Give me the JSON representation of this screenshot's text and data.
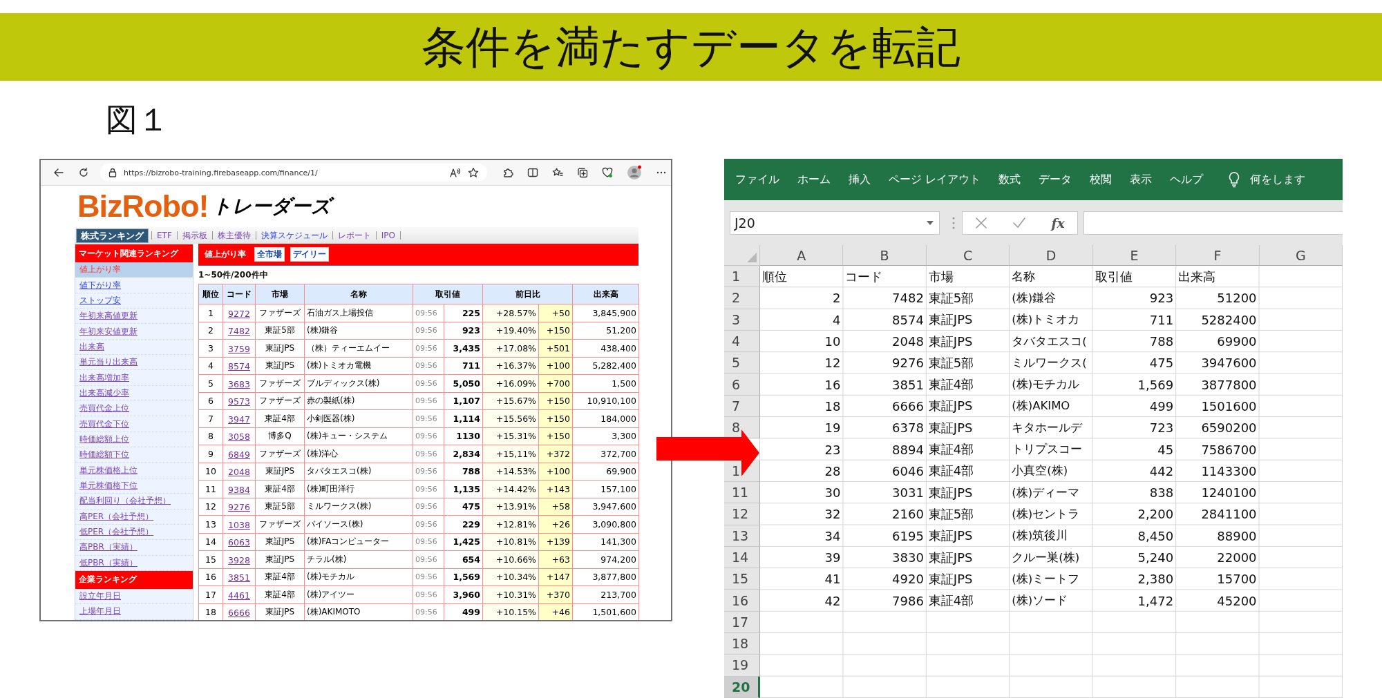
{
  "slide": {
    "title": "条件を満たすデータを転記",
    "figure_label": "図１"
  },
  "browser": {
    "url": "https://bizrobo-training.firebaseapp.com/finance/1/",
    "site": {
      "logo_text": "BizRobo!",
      "logo_subtitle": "トレーダーズ",
      "nav": [
        {
          "label": "株式ランキング",
          "selected": true,
          "visited": false
        },
        {
          "label": "ETF",
          "selected": false,
          "visited": true
        },
        {
          "label": "掲示板",
          "selected": false,
          "visited": true
        },
        {
          "label": "株主優待",
          "selected": false,
          "visited": true
        },
        {
          "label": "決算スケジュール",
          "selected": false,
          "visited": false
        },
        {
          "label": "レポート",
          "selected": false,
          "visited": true
        },
        {
          "label": "IPO",
          "selected": false,
          "visited": true
        }
      ],
      "sidebar": [
        {
          "kind": "header",
          "label": "マーケット関連ランキング"
        },
        {
          "kind": "link",
          "label": "値上がり率",
          "selected": true,
          "visited": false
        },
        {
          "kind": "link",
          "label": "値下がり率",
          "selected": false,
          "visited": false
        },
        {
          "kind": "link",
          "label": "ストップ安",
          "selected": false,
          "visited": false
        },
        {
          "kind": "link",
          "label": "年初来高値更新",
          "selected": false,
          "visited": true
        },
        {
          "kind": "link",
          "label": "年初来安値更新",
          "selected": false,
          "visited": true
        },
        {
          "kind": "link",
          "label": "出来高",
          "selected": false,
          "visited": true
        },
        {
          "kind": "link",
          "label": "単元当り出来高",
          "selected": false,
          "visited": true
        },
        {
          "kind": "link",
          "label": "出来高増加率",
          "selected": false,
          "visited": true
        },
        {
          "kind": "link",
          "label": "出来高減少率",
          "selected": false,
          "visited": true
        },
        {
          "kind": "link",
          "label": "売買代金上位",
          "selected": false,
          "visited": true
        },
        {
          "kind": "link",
          "label": "売買代金下位",
          "selected": false,
          "visited": true
        },
        {
          "kind": "link",
          "label": "時価総額上位",
          "selected": false,
          "visited": true
        },
        {
          "kind": "link",
          "label": "時価総額下位",
          "selected": false,
          "visited": true
        },
        {
          "kind": "link",
          "label": "単元株価格上位",
          "selected": false,
          "visited": true
        },
        {
          "kind": "link",
          "label": "単元株価格下位",
          "selected": false,
          "visited": true
        },
        {
          "kind": "link",
          "label": "配当利回り（会社予想）",
          "selected": false,
          "visited": true
        },
        {
          "kind": "link",
          "label": "高PER（会社予想）",
          "selected": false,
          "visited": true
        },
        {
          "kind": "link",
          "label": "低PER（会社予想）",
          "selected": false,
          "visited": true
        },
        {
          "kind": "link",
          "label": "高PBR（実績）",
          "selected": false,
          "visited": true
        },
        {
          "kind": "link",
          "label": "低PBR（実績）",
          "selected": false,
          "visited": true
        },
        {
          "kind": "header",
          "label": "企業ランキング"
        },
        {
          "kind": "link",
          "label": "設立年月日",
          "selected": false,
          "visited": true
        },
        {
          "kind": "link",
          "label": "上場年月日",
          "selected": false,
          "visited": true
        }
      ],
      "panel": {
        "title": "値上がり率",
        "filters": [
          "全市場",
          "デイリー"
        ],
        "count": "1~50件/200件中"
      },
      "table": {
        "columns": [
          "順位",
          "コード",
          "市場",
          "名称",
          "取引値",
          "前日比",
          "出来高"
        ],
        "rows": [
          {
            "rank": "1",
            "code": "9272",
            "market": "ファザーズ",
            "name": "石油ガス上場投信",
            "time": "09:56",
            "price": "225",
            "change_pct": "+28.57%",
            "change": "+50",
            "volume": "3,845,900"
          },
          {
            "rank": "2",
            "code": "7482",
            "market": "東証5部",
            "name": "(株)鎌谷",
            "time": "09:56",
            "price": "923",
            "change_pct": "+19.40%",
            "change": "+150",
            "volume": "51,200"
          },
          {
            "rank": "3",
            "code": "3759",
            "market": "東証JPS",
            "name": "（株）ティーエムイー",
            "time": "09:56",
            "price": "3,435",
            "change_pct": "+17.08%",
            "change": "+501",
            "volume": "438,400"
          },
          {
            "rank": "4",
            "code": "8574",
            "market": "東証JPS",
            "name": "(株)トミオカ電機",
            "time": "09:56",
            "price": "711",
            "change_pct": "+16.37%",
            "change": "+100",
            "volume": "5,282,400"
          },
          {
            "rank": "5",
            "code": "3683",
            "market": "ファザーズ",
            "name": "ブルディックス(株)",
            "time": "09:56",
            "price": "5,050",
            "change_pct": "+16.09%",
            "change": "+700",
            "volume": "1,500"
          },
          {
            "rank": "6",
            "code": "9573",
            "market": "ファザーズ",
            "name": "赤の製紙(株)",
            "time": "09:56",
            "price": "1,107",
            "change_pct": "+15.67%",
            "change": "+150",
            "volume": "10,910,100"
          },
          {
            "rank": "7",
            "code": "3947",
            "market": "東証4部",
            "name": "小剣医器(株)",
            "time": "09:56",
            "price": "1,114",
            "change_pct": "+15.56%",
            "change": "+150",
            "volume": "184,000"
          },
          {
            "rank": "8",
            "code": "3058",
            "market": "博多Q",
            "name": "(株)キュー・システム",
            "time": "09:56",
            "price": "1130",
            "change_pct": "+15.31%",
            "change": "+150",
            "volume": "3,300"
          },
          {
            "rank": "9",
            "code": "6849",
            "market": "ファザーズ",
            "name": "(株)洋心",
            "time": "09:56",
            "price": "2,834",
            "change_pct": "+15,11%",
            "change": "+372",
            "volume": "372,700"
          },
          {
            "rank": "10",
            "code": "2048",
            "market": "東証JPS",
            "name": "タバタエスコ(株)",
            "time": "09:56",
            "price": "788",
            "change_pct": "+14.53%",
            "change": "+100",
            "volume": "69,900"
          },
          {
            "rank": "11",
            "code": "9384",
            "market": "東証4部",
            "name": "(株)町田洋行",
            "time": "09:56",
            "price": "1,135",
            "change_pct": "+14.42%",
            "change": "+143",
            "volume": "157,100"
          },
          {
            "rank": "12",
            "code": "9276",
            "market": "東証5部",
            "name": "ミルワークス(株)",
            "time": "09:56",
            "price": "475",
            "change_pct": "+13.91%",
            "change": "+58",
            "volume": "3,947,600"
          },
          {
            "rank": "13",
            "code": "1038",
            "market": "ファザーズ",
            "name": "バイソース(株)",
            "time": "09:56",
            "price": "229",
            "change_pct": "+12.81%",
            "change": "+26",
            "volume": "3,090,800"
          },
          {
            "rank": "14",
            "code": "6063",
            "market": "東証JPS",
            "name": "(株)FAコンピューター",
            "time": "09:56",
            "price": "1,425",
            "change_pct": "+10.81%",
            "change": "+139",
            "volume": "141,300"
          },
          {
            "rank": "15",
            "code": "3928",
            "market": "東証JPS",
            "name": "チラル(株)",
            "time": "09:56",
            "price": "654",
            "change_pct": "+10.66%",
            "change": "+63",
            "volume": "974,200"
          },
          {
            "rank": "16",
            "code": "3851",
            "market": "東証4部",
            "name": "(株)モチカル",
            "time": "09:56",
            "price": "1,569",
            "change_pct": "+10.34%",
            "change": "+147",
            "volume": "3,877,800"
          },
          {
            "rank": "17",
            "code": "4461",
            "market": "東証4部",
            "name": "(株)アイツー",
            "time": "09:56",
            "price": "3,960",
            "change_pct": "+10.31%",
            "change": "+370",
            "volume": "213,700"
          },
          {
            "rank": "18",
            "code": "6666",
            "market": "東証JPS",
            "name": "(株)AKIMOTO",
            "time": "09:56",
            "price": "499",
            "change_pct": "+10.15%",
            "change": "+46",
            "volume": "1,501,600"
          }
        ]
      }
    }
  },
  "excel": {
    "tabs": [
      "ファイル",
      "ホーム",
      "挿入",
      "ページ レイアウト",
      "数式",
      "データ",
      "校閲",
      "表示",
      "ヘルプ"
    ],
    "tell_me": "何をします",
    "name_box": "J20",
    "fx": "fx",
    "columns": [
      "A",
      "B",
      "C",
      "D",
      "E",
      "F",
      "G"
    ],
    "rows": [
      {
        "header": "1",
        "selected": false,
        "kind": "header",
        "cells": [
          "順位",
          "コード",
          "市場",
          "名称",
          "取引値",
          "出来高"
        ]
      },
      {
        "header": "2",
        "selected": false,
        "kind": "data",
        "cells": [
          "2",
          "7482",
          "東証5部",
          "(株)鎌谷",
          "923",
          "51200"
        ]
      },
      {
        "header": "3",
        "selected": false,
        "kind": "data",
        "cells": [
          "4",
          "8574",
          "東証JPS",
          "(株)トミオカ",
          "711",
          "5282400"
        ]
      },
      {
        "header": "4",
        "selected": false,
        "kind": "data",
        "cells": [
          "10",
          "2048",
          "東証JPS",
          "タバタエスコ(",
          "788",
          "69900"
        ]
      },
      {
        "header": "5",
        "selected": false,
        "kind": "data",
        "cells": [
          "12",
          "9276",
          "東証5部",
          "ミルワークス(",
          "475",
          "3947600"
        ]
      },
      {
        "header": "6",
        "selected": false,
        "kind": "data",
        "cells": [
          "16",
          "3851",
          "東証4部",
          "(株)モチカル",
          "1,569",
          "3877800"
        ]
      },
      {
        "header": "7",
        "selected": false,
        "kind": "data",
        "cells": [
          "18",
          "6666",
          "東証JPS",
          "(株)AKIMO",
          "499",
          "1501600"
        ]
      },
      {
        "header": "8",
        "selected": false,
        "kind": "data",
        "cells": [
          "19",
          "6378",
          "東証JPS",
          "キタホールデ",
          "723",
          "6590200"
        ]
      },
      {
        "selected": false,
        "kind": "data",
        "cells": [
          "23",
          "8894",
          "東証4部",
          "トリプスコー",
          "45",
          "7586700"
        ]
      },
      {
        "header": "1",
        "selected": false,
        "kind": "data",
        "cells": [
          "28",
          "6046",
          "東証4部",
          "小真空(株)",
          "442",
          "1143300"
        ]
      },
      {
        "header": "11",
        "selected": false,
        "kind": "data",
        "cells": [
          "30",
          "3031",
          "東証JPS",
          "(株)ディーマ",
          "838",
          "1240100"
        ]
      },
      {
        "header": "12",
        "selected": false,
        "kind": "data",
        "cells": [
          "32",
          "2160",
          "東証5部",
          "(株)セントラ",
          "2,200",
          "2841100"
        ]
      },
      {
        "header": "13",
        "selected": false,
        "kind": "data",
        "cells": [
          "34",
          "6195",
          "東証JPS",
          "(株)筑後川",
          "8,450",
          "88900"
        ]
      },
      {
        "header": "14",
        "selected": false,
        "kind": "data",
        "cells": [
          "39",
          "3830",
          "東証JPS",
          "クルー巣(株)",
          "5,240",
          "22000"
        ]
      },
      {
        "header": "15",
        "selected": false,
        "kind": "data",
        "cells": [
          "41",
          "4920",
          "東証JPS",
          "(株)ミートフ",
          "2,380",
          "15700"
        ]
      },
      {
        "header": "16",
        "selected": false,
        "kind": "data",
        "cells": [
          "42",
          "7986",
          "東証4部",
          "(株)ソード",
          "1,472",
          "45200"
        ]
      },
      {
        "header": "17",
        "selected": false,
        "kind": "empty"
      },
      {
        "header": "18",
        "selected": false,
        "kind": "empty"
      },
      {
        "header": "19",
        "selected": false,
        "kind": "empty"
      },
      {
        "header": "20",
        "selected": true,
        "kind": "empty"
      }
    ]
  }
}
